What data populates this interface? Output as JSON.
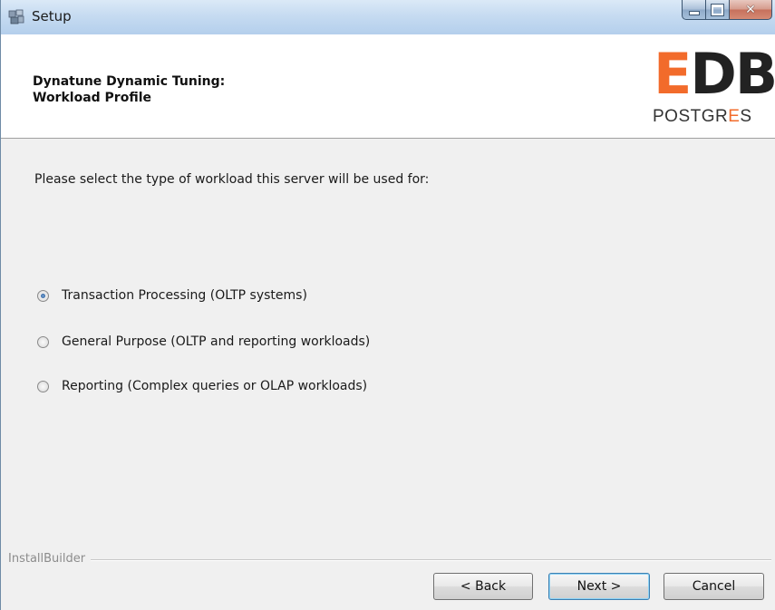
{
  "window": {
    "title": "Setup",
    "icon": "setup-app-icon"
  },
  "header": {
    "title_line1": "Dynatune Dynamic Tuning:",
    "title_line2": "Workload Profile",
    "logo_top": "EDB",
    "logo_bottom": "POSTGRES",
    "logo_accent_color": "#f26b2b"
  },
  "body": {
    "prompt": "Please select the type of workload this server will be used for:",
    "options": [
      {
        "label": "Transaction Processing (OLTP systems)",
        "selected": true
      },
      {
        "label": "General Purpose (OLTP and reporting workloads)",
        "selected": false
      },
      {
        "label": "Reporting (Complex queries or OLAP workloads)",
        "selected": false
      }
    ]
  },
  "footer": {
    "brand": "InstallBuilder",
    "back_label": "< Back",
    "next_label": "Next >",
    "cancel_label": "Cancel"
  }
}
